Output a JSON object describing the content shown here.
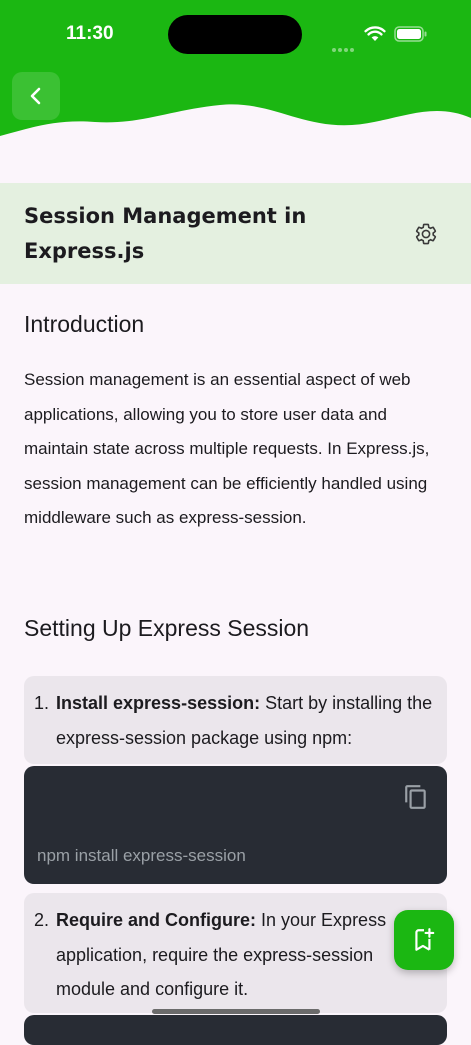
{
  "status_bar": {
    "time": "11:30"
  },
  "header": {
    "title": "Session Management in Express.js"
  },
  "content": {
    "intro_heading": "Introduction",
    "intro_text": "Session management is an essential aspect of web applications, allowing you to store user data and maintain state across multiple requests. In Express.js, session management can be efficiently handled using middleware such as express-session.",
    "setup_heading": "Setting Up Express Session",
    "steps": [
      {
        "number": "1.",
        "title": "Install express-session:",
        "text": " Start by installing the express-session package using npm:"
      },
      {
        "number": "2.",
        "title": "Require and Configure:",
        "text": " In your Express application, require the express-session module and configure it."
      }
    ],
    "code_1": "npm install express-session"
  },
  "colors": {
    "brand": "#1bb712",
    "title_bar": "#e4f0e0",
    "code_bg": "#282c34"
  },
  "icons": [
    "back-arrow-icon",
    "gear-icon",
    "copy-icon",
    "bookmark-add-icon",
    "wifi-icon",
    "battery-icon"
  ]
}
